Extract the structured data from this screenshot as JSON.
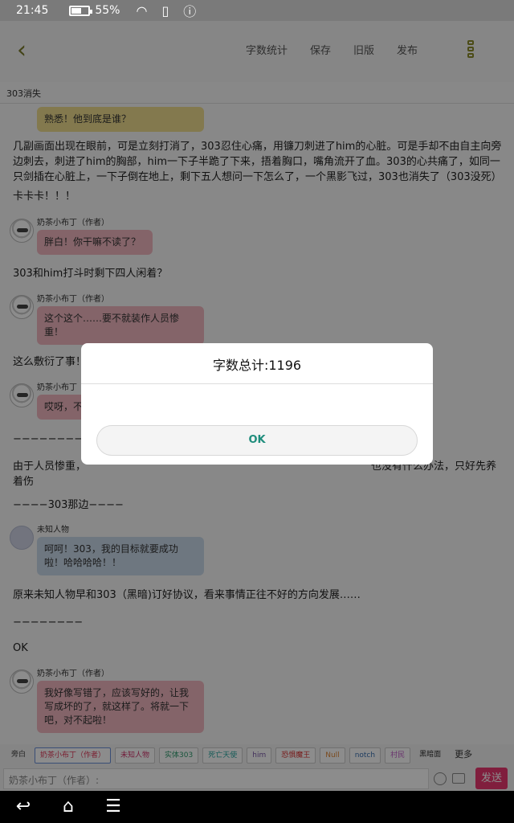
{
  "status_bar": {
    "time": "21:45",
    "battery": "55%",
    "battery_level": 0.55
  },
  "toolbar": {
    "actions": [
      "字数统计",
      "保存",
      "旧版",
      "发布"
    ]
  },
  "subtitle": "303消失",
  "content": {
    "top_bubble": "熟悉！他到底是谁？",
    "p1": "几副画面出现在眼前，可是立刻打消了，303忍住心痛，用镰刀刺进了him的心脏。可是手却不由自主向旁边刺去，刺进了him的胸部，him一下子半跪了下来，捂着胸口，嘴角流开了血。303的心共痛了，如同一只剑插在心脏上，一下子倒在地上，剩下五人想问一下怎么了，一个黑影飞过，303也消失了（303没死）",
    "p2": "卡卡卡！！！",
    "msg1": {
      "name": "奶茶小布丁（作者）",
      "text": "胖白！你干嘛不读了？"
    },
    "p3": "303和him打斗时剩下四人闲着？",
    "msg2": {
      "name": "奶茶小布丁（作者）",
      "text": "这个这个……要不就装作人员惨重！"
    },
    "p4": "这么敷衍了事！",
    "msg3": {
      "name": "奶茶小布丁",
      "text": "哎呀，不"
    },
    "p5": "−−−−−−−−−",
    "p6a": "由于人员惨重，",
    "p6b": "也没有什么办法，只好先养着伤",
    "p7": "−−−−303那边−−−−",
    "msg4": {
      "name": "未知人物",
      "text": "呵呵！303，我的目标就要成功啦！哈哈哈哈！！"
    },
    "p8": "原来未知人物早和303（黑暗)订好协议，看来事情正往不好的方向发展……",
    "p9": "−−−−−−−−",
    "p10": "OK",
    "msg5": {
      "name": "奶茶小布丁（作者）",
      "text": "我好像写错了，应该写好的，让我写成坏的了，就这样了。将就一下吧，对不起啦！"
    }
  },
  "roles": [
    {
      "label": "旁白",
      "color": "#444444"
    },
    {
      "label": "奶茶小布丁（作者）",
      "color": "#e03a5a"
    },
    {
      "label": "未知人物",
      "color": "#d0356d"
    },
    {
      "label": "实体303",
      "color": "#2e9b6e"
    },
    {
      "label": "死亡天使",
      "color": "#29a6a0"
    },
    {
      "label": "him",
      "color": "#7b5aa6"
    },
    {
      "label": "恐惧魔王",
      "color": "#d93030"
    },
    {
      "label": "Null",
      "color": "#e0893a"
    },
    {
      "label": "notch",
      "color": "#3a6fb0"
    },
    {
      "label": "村民",
      "color": "#c25fc8"
    },
    {
      "label": "黑暗面",
      "color": "#333333"
    },
    {
      "label": "更多",
      "color": "#333333"
    }
  ],
  "input": {
    "placeholder": "奶茶小布丁（作者）:"
  },
  "send_label": "发送",
  "dialog": {
    "title": "字数总计:1196",
    "ok_label": "OK"
  }
}
